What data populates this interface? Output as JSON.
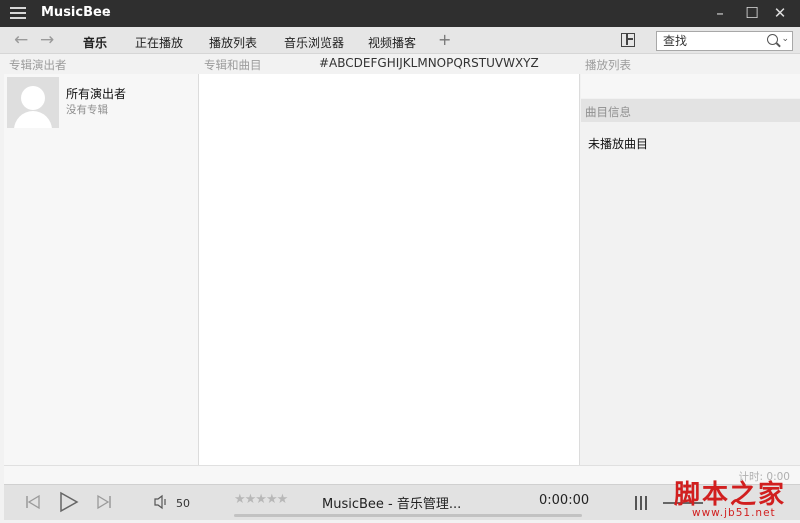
{
  "titlebar": {
    "app_name": "MusicBee",
    "menu_icon": "hamburger-menu-icon",
    "dropdown_icon": "chevron-down-icon",
    "minimize_icon": "minimize-icon",
    "maximize_icon": "maximize-icon",
    "close_icon": "close-icon"
  },
  "nav": {
    "back_icon": "arrow-left-icon",
    "forward_icon": "arrow-right-icon",
    "tabs": [
      {
        "label": "音乐",
        "active": true
      },
      {
        "label": "正在播放",
        "active": false
      },
      {
        "label": "播放列表",
        "active": false
      },
      {
        "label": "音乐浏览器",
        "active": false
      },
      {
        "label": "视频播客",
        "active": false
      }
    ],
    "add_tab": "+",
    "layout_icon": "layout-icon",
    "search": {
      "value": "",
      "placeholder": "查找",
      "icon": "search-icon"
    }
  },
  "header": {
    "artists_col": "专辑演出者",
    "albums_col": "专辑和曲目",
    "alphabet": "#ABCDEFGHIJKLMNOPQRSTUVWXYZ",
    "playlist_col": "播放列表"
  },
  "left_panel": {
    "artist_name": "所有演出者",
    "artist_sub": "没有专辑"
  },
  "right_panel": {
    "info_header": "曲目信息",
    "no_track": "未播放曲目"
  },
  "status": {
    "timer": "计时: 0:00"
  },
  "player": {
    "volume": "50",
    "rating_stars": "★★★★★",
    "rating": 0,
    "track_title": "MusicBee - 音乐管理...",
    "time": "0:00:00",
    "progress": 0
  },
  "watermark": {
    "text": "脚本之家",
    "url": "www.jb51.net"
  },
  "colors": {
    "titlebar_bg": "#2f2f2f",
    "accent_red": "#d11f1f"
  }
}
